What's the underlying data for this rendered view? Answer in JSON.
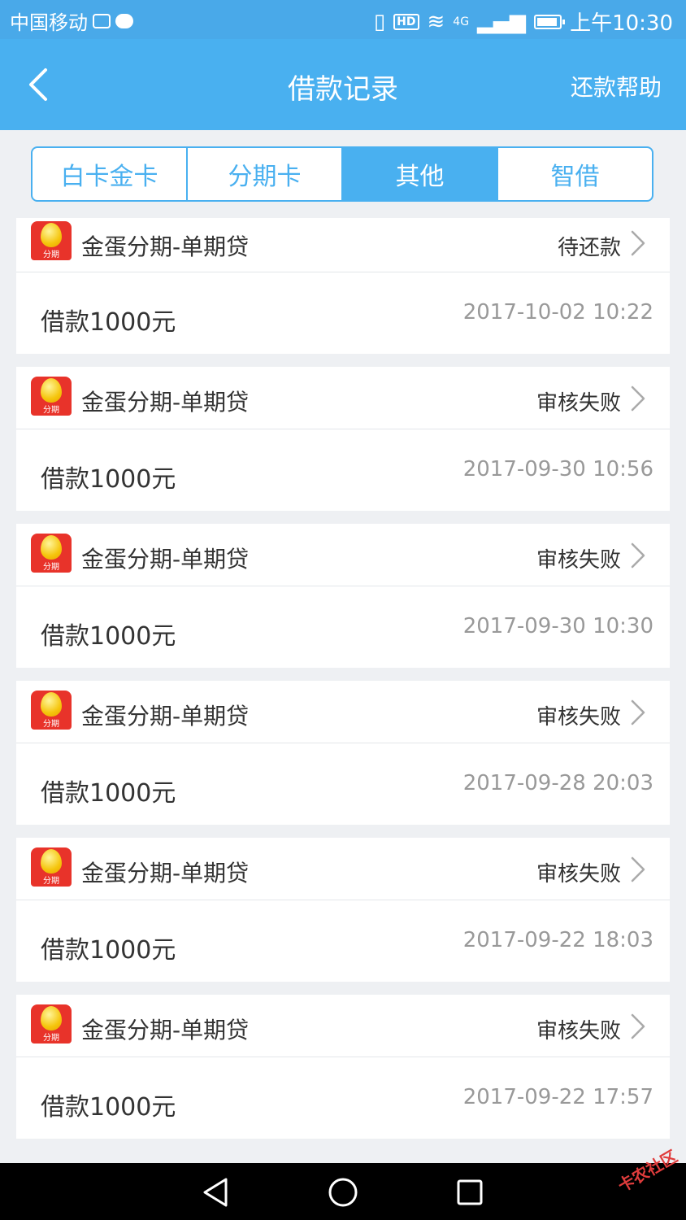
{
  "status_bar": {
    "carrier": "中国移动",
    "network": "4G",
    "hd": "HD",
    "time": "上午10:30"
  },
  "header": {
    "title": "借款记录",
    "help_label": "还款帮助"
  },
  "tabs": [
    {
      "label": "白卡金卡",
      "active": false
    },
    {
      "label": "分期卡",
      "active": false
    },
    {
      "label": "其他",
      "active": true
    },
    {
      "label": "智借",
      "active": false
    }
  ],
  "loans": [
    {
      "logo_text": "分期",
      "name": "金蛋分期-单期贷",
      "status": "待还款",
      "amount": "借款1000元",
      "time": "2017-10-02 10:22"
    },
    {
      "logo_text": "分期",
      "name": "金蛋分期-单期贷",
      "status": "审核失败",
      "amount": "借款1000元",
      "time": "2017-09-30 10:56"
    },
    {
      "logo_text": "分期",
      "name": "金蛋分期-单期贷",
      "status": "审核失败",
      "amount": "借款1000元",
      "time": "2017-09-30 10:30"
    },
    {
      "logo_text": "分期",
      "name": "金蛋分期-单期贷",
      "status": "审核失败",
      "amount": "借款1000元",
      "time": "2017-09-28 20:03"
    },
    {
      "logo_text": "分期",
      "name": "金蛋分期-单期贷",
      "status": "审核失败",
      "amount": "借款1000元",
      "time": "2017-09-22 18:03"
    },
    {
      "logo_text": "分期",
      "name": "金蛋分期-单期贷",
      "status": "审核失败",
      "amount": "借款1000元",
      "time": "2017-09-22 17:57"
    }
  ],
  "nav": {
    "back_icon": "triangle-back-icon",
    "home_icon": "circle-home-icon",
    "recents_icon": "square-recents-icon"
  },
  "watermark": "卡农社区",
  "colors": {
    "accent": "#49b0f0",
    "status_bar": "#49a9e9",
    "logo_red": "#e8332a"
  }
}
